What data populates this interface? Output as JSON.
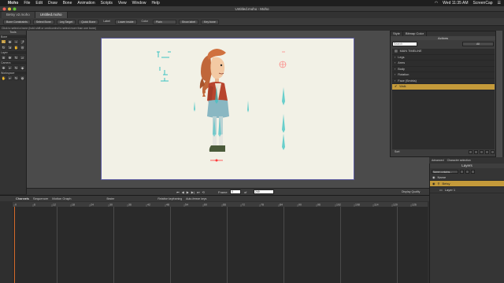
{
  "menubar": {
    "app": "Moho",
    "items": [
      "File",
      "Edit",
      "Draw",
      "Bone",
      "Animation",
      "Scripts",
      "View",
      "Window",
      "Help"
    ],
    "clock": "Wed 11:35 AM",
    "screencap": "ScreenCap"
  },
  "window": {
    "title": "Untitled.moho - Moho"
  },
  "doc_tabs": [
    "Betsy v2.moho",
    "Untitled.moho"
  ],
  "options": {
    "bone_constraints": "Bone Constraints",
    "select_bone": "Select Bone",
    "leg_target": "Leg Target",
    "quick_bone": "Quick Bone",
    "label": "Label",
    "lower_inside": "Lower inside",
    "color_label": "Color",
    "color_value": "Plain",
    "show_label": "Show label",
    "key_bone": "Key bone"
  },
  "hint": "Click to select a bone (hold shift or cmd/control to select more than one bone)",
  "tools": {
    "title": "Tools",
    "sections": [
      "Bone",
      "Layer",
      "Camera",
      "Workspace"
    ]
  },
  "actions_panel": {
    "tabs": [
      "Style",
      "Bitmap Color"
    ],
    "title": "Actions",
    "search_placeholder": "Search",
    "filter": "All",
    "items": [
      "MAIN TIMELINE",
      "Legs",
      "Arms",
      "Body",
      "Rotation",
      "Face (Smirks)",
      "Walk"
    ],
    "selected": "Walk",
    "sort_label": "Sort",
    "footer_left": "Advanced",
    "footer_right": "Character selection"
  },
  "layers_panel": {
    "title": "Layers",
    "filter": "Name contains...",
    "rows": [
      {
        "name": "Name"
      },
      {
        "name": "Betsy"
      },
      {
        "name": "Layer 1"
      }
    ],
    "selected": "Betsy"
  },
  "playbar": {
    "frame_label": "Frame",
    "frame_value": "0",
    "of_label": "of",
    "end_value": "240",
    "display_quality": "Display Quality"
  },
  "timeline": {
    "tabs": [
      "Channels",
      "Sequencer",
      "Motion Graph"
    ],
    "interp": "Bezier",
    "relative_kf": "Relative keyframing",
    "auto_freeze": "Auto-freeze keys",
    "ticks": [
      "0",
      "6",
      "12",
      "18",
      "24",
      "30",
      "36",
      "42",
      "48",
      "54",
      "60",
      "66",
      "72",
      "78",
      "84",
      "90",
      "96",
      "102",
      "108",
      "114",
      "120",
      "126",
      "132"
    ]
  },
  "colors": {
    "accent": "#c49a3a",
    "stage_bg": "#f2f1e6",
    "bone": "#3bc3c3"
  }
}
